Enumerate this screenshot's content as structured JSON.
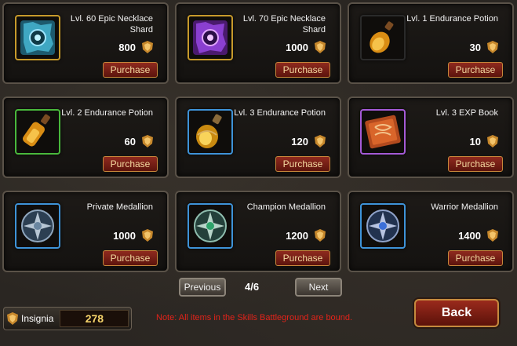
{
  "items": [
    {
      "name": "Lvl. 60 Epic Necklace Shard",
      "price": "800",
      "button": "Purchase",
      "frame": "gold",
      "icon": "necklace-shard-blue-icon"
    },
    {
      "name": "Lvl. 70 Epic Necklace Shard",
      "price": "1000",
      "button": "Purchase",
      "frame": "gold",
      "icon": "necklace-shard-purple-icon"
    },
    {
      "name": "Lvl. 1 Endurance Potion",
      "price": "30",
      "button": "Purchase",
      "frame": "black",
      "icon": "potion-icon"
    },
    {
      "name": "Lvl. 2 Endurance Potion",
      "price": "60",
      "button": "Purchase",
      "frame": "green",
      "icon": "potion-icon"
    },
    {
      "name": "Lvl. 3 Endurance Potion",
      "price": "120",
      "button": "Purchase",
      "frame": "blue",
      "icon": "potion-icon"
    },
    {
      "name": "Lvl. 3 EXP Book",
      "price": "10",
      "button": "Purchase",
      "frame": "purple",
      "icon": "book-icon"
    },
    {
      "name": "Private Medallion",
      "price": "1000",
      "button": "Purchase",
      "frame": "blue",
      "icon": "medallion-icon"
    },
    {
      "name": "Champion Medallion",
      "price": "1200",
      "button": "Purchase",
      "frame": "blue",
      "icon": "medallion-green-icon"
    },
    {
      "name": "Warrior Medallion",
      "price": "1400",
      "button": "Purchase",
      "frame": "blue",
      "icon": "medallion-blue-icon"
    }
  ],
  "pagination": {
    "previous": "Previous",
    "page": "4/6",
    "next": "Next"
  },
  "insignia": {
    "label": "Insignia",
    "value": "278"
  },
  "note": "Note: All items in the Skills Battleground are bound.",
  "back": "Back",
  "colors": {
    "accent_red": "#e2231a",
    "gold": "#c79a2b",
    "value_gold": "#f5d36a"
  }
}
